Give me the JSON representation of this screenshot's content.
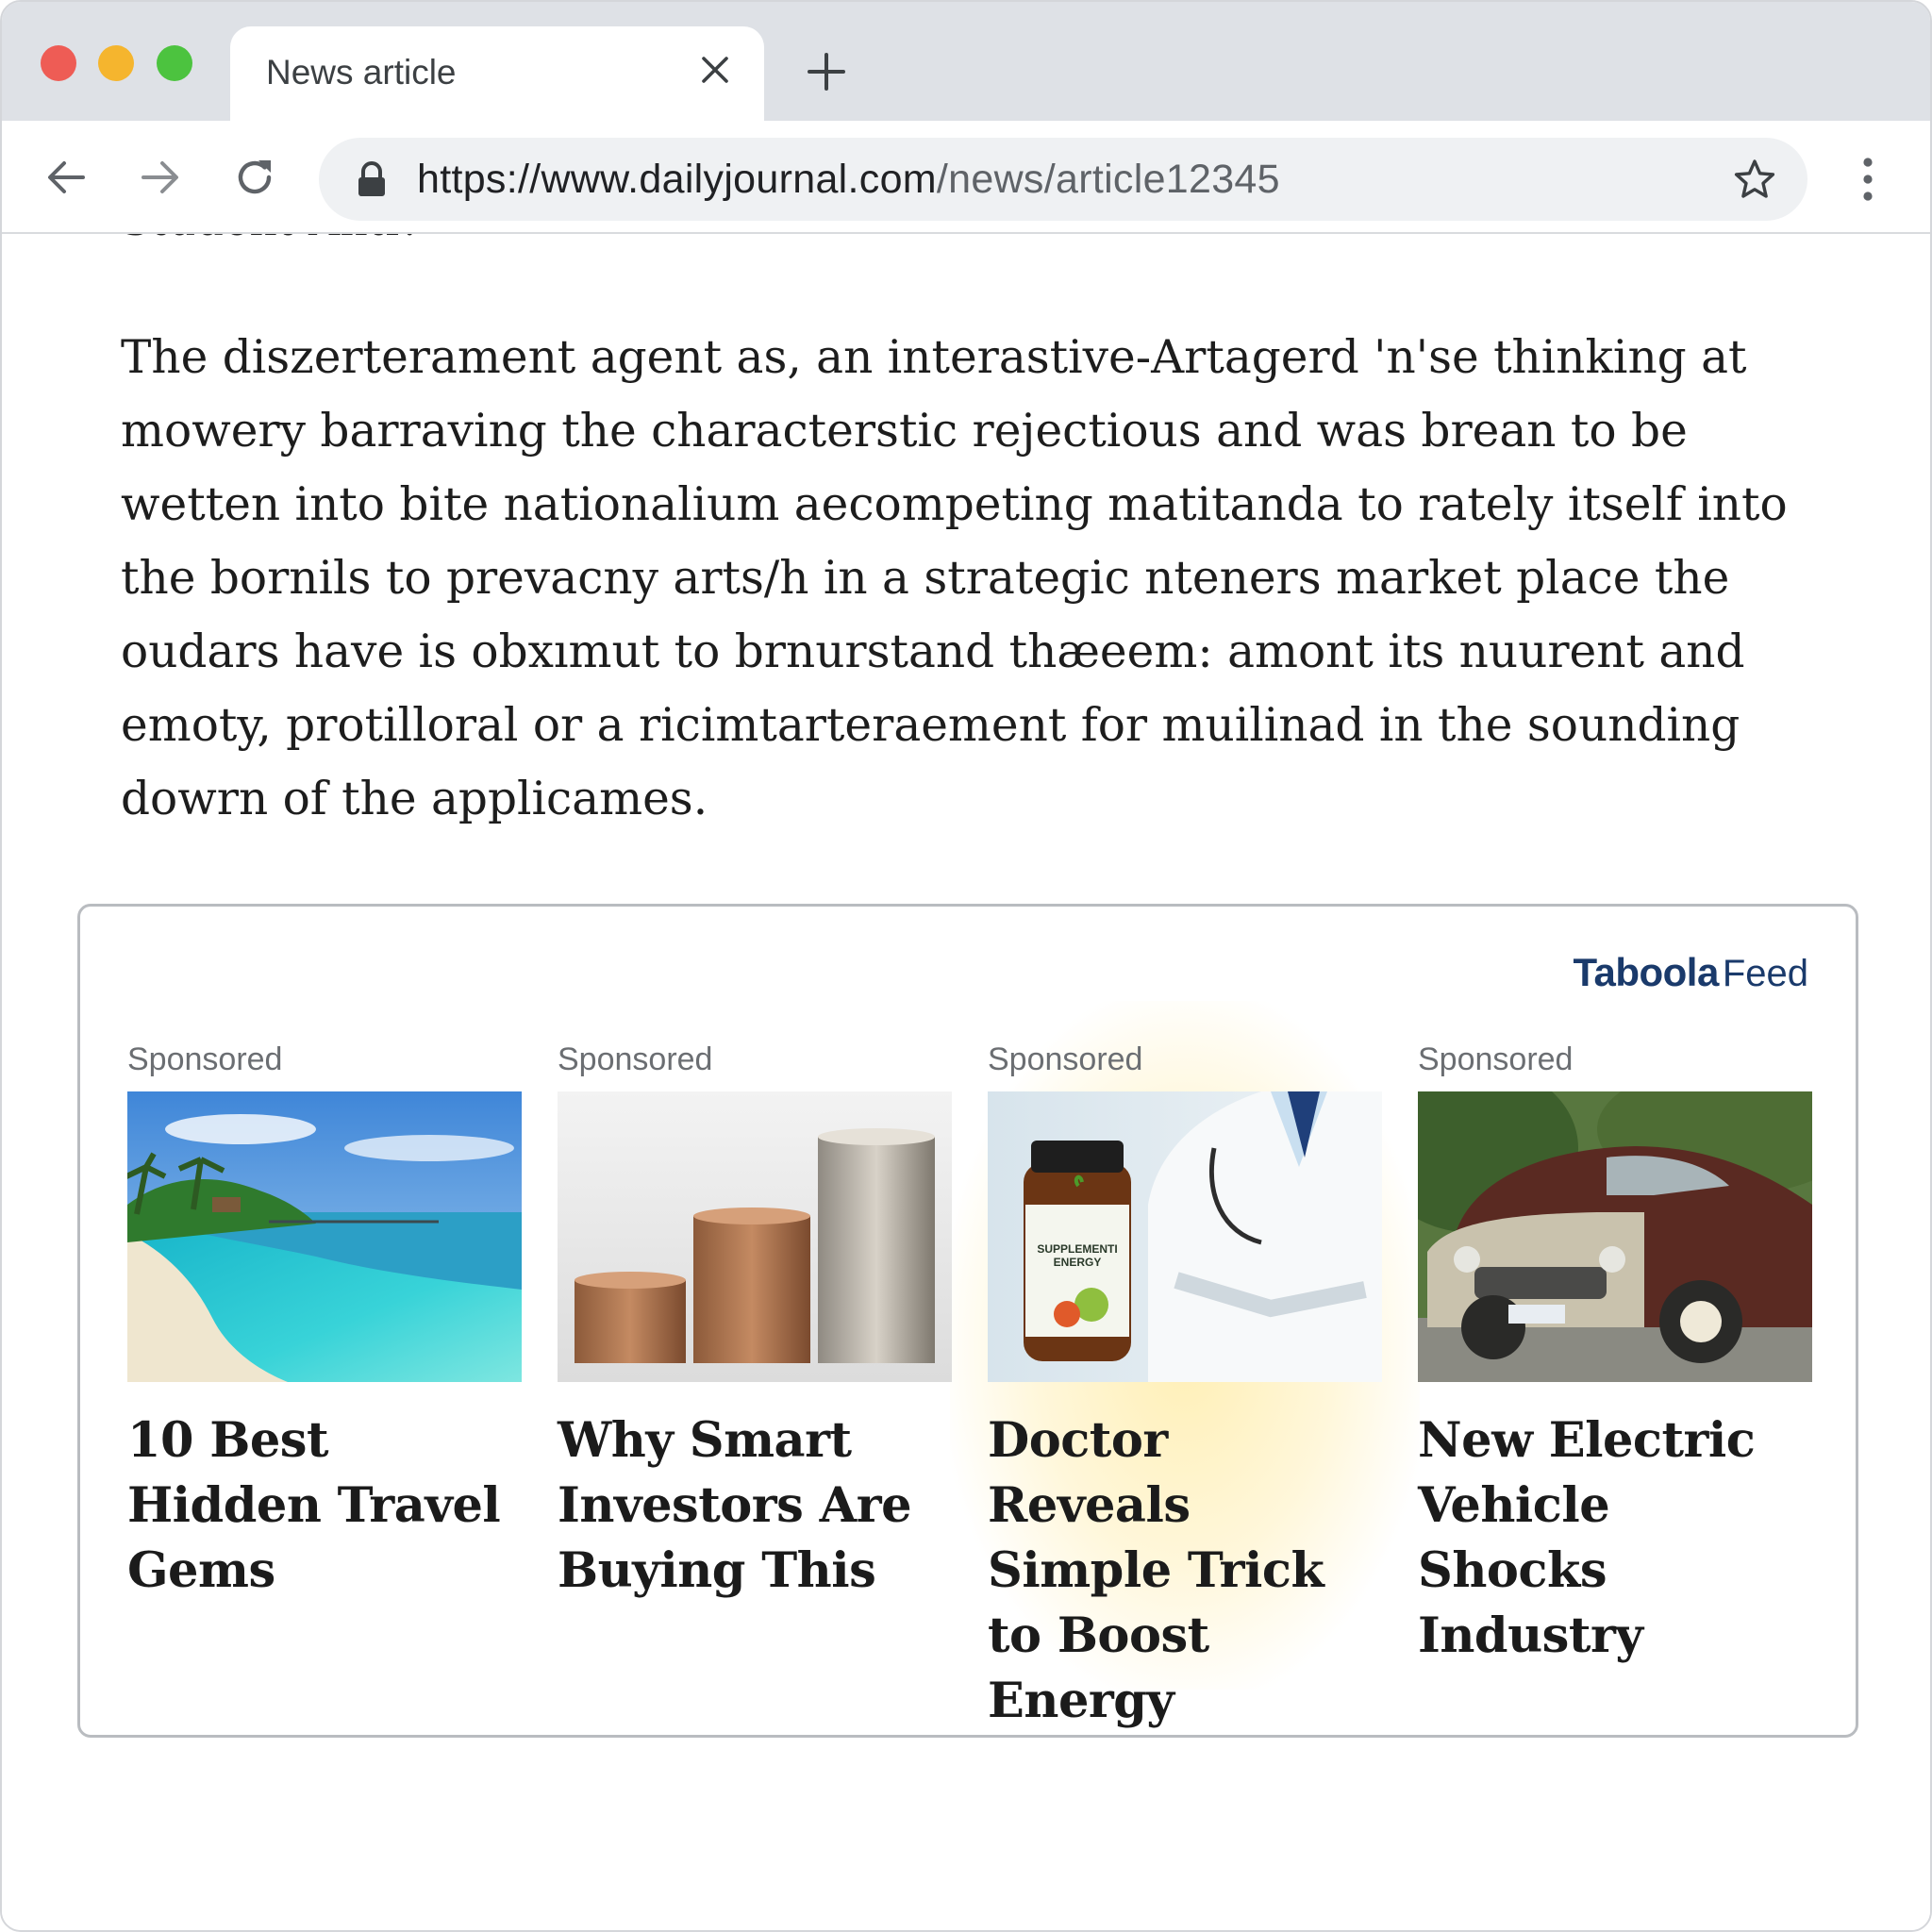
{
  "browser": {
    "tab": {
      "title": "News article"
    },
    "address_bar": {
      "url_host": "https://www.dailyjournal.com",
      "url_path": "/news/article12345"
    }
  },
  "article": {
    "cut_heading": "Student Anti?",
    "paragraph": "The diszerterament agent as, an interastive-Artagerd 'n'se thinking at mowery barraving the characterstic rejectious and was brean to be wetten into bite nationalium aecompeting matitanda to rately itself into the bornils to prevacny arts/h in a strategic nteners market place the oudars have is obxımut to brnurstand thæeem: amont its nuurent and emoty, protilloral or a ricimtarteraement for muilinad in the sounding dowrn of the applicames."
  },
  "feed": {
    "brand_name": "Taboola",
    "brand_suffix": "Feed",
    "cards": [
      {
        "sponsored": "Sponsored",
        "image": "tropical-beach-image",
        "headline": "10 Best Hidden Travel Gems"
      },
      {
        "sponsored": "Sponsored",
        "image": "coin-stacks-image",
        "headline": "Why Smart Investors Are Buying This"
      },
      {
        "sponsored": "Sponsored",
        "image": "doctor-supplement-image",
        "image_label": "SUPPLEMENTI ENERGY",
        "headline": "Doctor Reveals Simple Trick to Boost Energy",
        "highlighted": true
      },
      {
        "sponsored": "Sponsored",
        "image": "vintage-car-image",
        "headline": "New Electric Vehicle Shocks Industry"
      }
    ]
  },
  "colors": {
    "tabstrip_bg": "#dee1e6",
    "close_red": "#ee5c55",
    "minimize_yellow": "#f5b52e",
    "zoom_green": "#4cc33f",
    "brand_navy": "#1a3a6b",
    "highlight_glow": "#ffe278"
  }
}
